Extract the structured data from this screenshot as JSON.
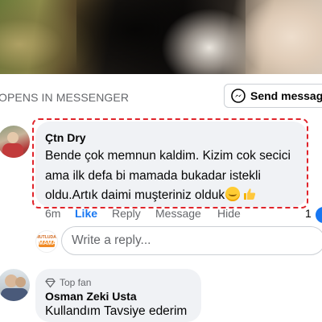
{
  "messenger_bar": {
    "opens_label": "OPENS IN MESSENGER",
    "send_button_label": "Send message",
    "send_icon": "messenger-icon"
  },
  "comment_1": {
    "author": "Çtn Dry",
    "text": "Bende çok memnun kaldim. Kizim cok secici ama ilk defa bi mamada bukadar istekli oldu.Artık daimi muşteriniz olduk",
    "emojis": [
      "smiling-face-emoji",
      "thumbs-up-emoji"
    ],
    "time": "6m",
    "actions": {
      "like": "Like",
      "reply": "Reply",
      "message": "Message",
      "hide": "Hide"
    },
    "reaction_count": "1",
    "highlight_color": "#e0242b"
  },
  "reply_box": {
    "avatar_logo_top": "MUTLUDAN",
    "avatar_logo_bottom": "MAMA",
    "placeholder": "Write a reply..."
  },
  "comment_2": {
    "badge": "Top fan",
    "badge_icon": "diamond-icon",
    "author": "Osman Zeki Usta",
    "text": "Kullandım Tavsiye ederim"
  },
  "colors": {
    "link_blue": "#1877f2",
    "secondary_text": "#65676b",
    "bubble_bg": "#f0f2f5"
  }
}
